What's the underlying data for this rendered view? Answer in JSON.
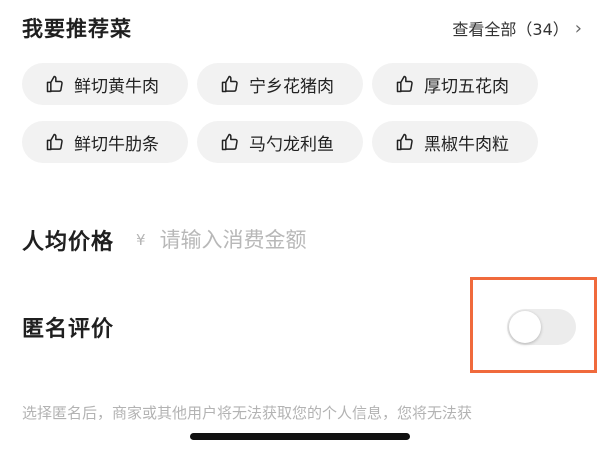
{
  "recommend": {
    "title": "我要推荐菜",
    "view_all": "查看全部（34）",
    "chevron": "›",
    "dishes": [
      {
        "label": "鲜切黄牛肉",
        "icon": "thumbs-up-icon"
      },
      {
        "label": "宁乡花猪肉",
        "icon": "thumbs-up-icon"
      },
      {
        "label": "厚切五花肉",
        "icon": "thumbs-up-icon"
      },
      {
        "label": "鲜切牛肋条",
        "icon": "thumbs-up-icon"
      },
      {
        "label": "马勺龙利鱼",
        "icon": "thumbs-up-icon"
      },
      {
        "label": "黑椒牛肉粒",
        "icon": "thumbs-up-icon"
      }
    ]
  },
  "price": {
    "label": "人均价格",
    "currency": "¥",
    "placeholder": "请输入消费金额",
    "value": ""
  },
  "anonymous": {
    "label": "匿名评价",
    "enabled": false,
    "highlight_color": "#f06a3c",
    "disclaimer": "选择匿名后，商家或其他用户将无法获取您的个人信息，您将无法获"
  }
}
